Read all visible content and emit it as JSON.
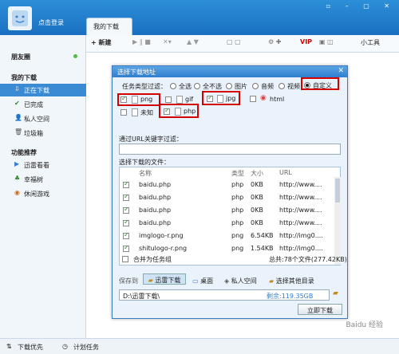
{
  "top": {
    "login": "点击登录",
    "tab": "我的下载",
    "controls": "▫ – ▢ ✕"
  },
  "sidebar": {
    "friends": "朋友圈",
    "my_downloads": "我的下载",
    "items": [
      "正在下载",
      "已完成",
      "私人空间",
      "垃圾箱"
    ],
    "featured": "功能推荐",
    "feature_items": [
      "迅雷看看",
      "幸福树",
      "休闲游戏"
    ]
  },
  "toolbar": {
    "new": "+ 新建",
    "tools": "小工具",
    "vip": "VIP"
  },
  "dialog": {
    "title": "选择下载地址",
    "type_filter_label": "任务类型过滤：",
    "filters": [
      "全选",
      "全不选",
      "图片",
      "音频",
      "视频",
      "自定义"
    ],
    "types_row1": [
      "png",
      "gif",
      "jpg",
      "html"
    ],
    "types_row2": [
      "未知",
      "php"
    ],
    "url_filter_label": "通过URL关键字过滤：",
    "files_label": "选择下载的文件：",
    "headers": [
      "名称",
      "类型",
      "大小",
      "URL"
    ],
    "files": [
      {
        "name": "baidu.php",
        "type": "php",
        "size": "0KB",
        "url": "http://www...."
      },
      {
        "name": "baidu.php",
        "type": "php",
        "size": "0KB",
        "url": "http://www...."
      },
      {
        "name": "baidu.php",
        "type": "php",
        "size": "0KB",
        "url": "http://www...."
      },
      {
        "name": "baidu.php",
        "type": "php",
        "size": "0KB",
        "url": "http://www...."
      },
      {
        "name": "imglogo-r.png",
        "type": "png",
        "size": "6.54KB",
        "url": "http://img0...."
      },
      {
        "name": "shitulogo-r.png",
        "type": "png",
        "size": "1.54KB",
        "url": "http://img0...."
      }
    ],
    "merge_label": "合并为任务组",
    "total": "总共:78个文件(277.42KB)",
    "save_to_label": "保存到",
    "locations": [
      "迅雷下载",
      "桌面",
      "私人空间",
      "选择其他目录"
    ],
    "path": "D:\\迅雷下载\\",
    "free_space": "剩余:119.35GB",
    "download_button": "立即下载"
  },
  "status": {
    "priority": "下载优先",
    "schedule": "计划任务"
  },
  "watermark": "Baidu 经验"
}
